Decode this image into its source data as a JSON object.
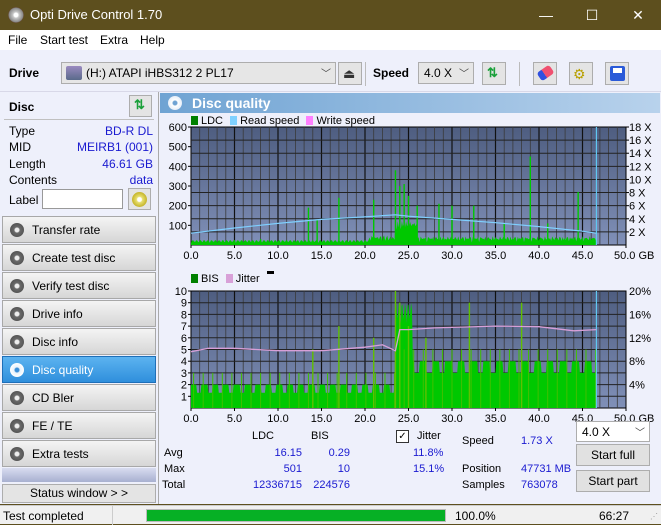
{
  "window": {
    "title": "Opti Drive Control 1.70",
    "minimize": "—",
    "maximize": "☐",
    "close": "✕"
  },
  "menu": [
    "File",
    "Start test",
    "Extra",
    "Help"
  ],
  "toolbar": {
    "drive_label": "Drive",
    "drive_value": "(H:)  ATAPI iHBS312  2 PL17",
    "speed_label": "Speed",
    "speed_value": "4.0 X"
  },
  "disc": {
    "header": "Disc",
    "rows": [
      {
        "key": "Type",
        "value": "BD-R DL"
      },
      {
        "key": "MID",
        "value": "MEIRB1 (001)"
      },
      {
        "key": "Length",
        "value": "46.61 GB"
      },
      {
        "key": "Contents",
        "value": "data"
      }
    ],
    "label_key": "Label",
    "label_value": ""
  },
  "nav": [
    {
      "label": "Transfer rate",
      "active": false
    },
    {
      "label": "Create test disc",
      "active": false
    },
    {
      "label": "Verify test disc",
      "active": false
    },
    {
      "label": "Drive info",
      "active": false
    },
    {
      "label": "Disc info",
      "active": false
    },
    {
      "label": "Disc quality",
      "active": true
    },
    {
      "label": "CD Bler",
      "active": false
    },
    {
      "label": "FE / TE",
      "active": false
    },
    {
      "label": "Extra tests",
      "active": false
    }
  ],
  "status_window_btn": "Status window > >",
  "panel_title": "Disc quality",
  "colors": {
    "ldc": "#00c800",
    "read_speed": "#7fd0ff",
    "write_speed": "#ff80ff",
    "bis": "#00c800",
    "jitter": "#d8a0d8",
    "plot_bg_top": "#4e5d80",
    "plot_bg_bottom": "#8090b8",
    "progress": "#06b025"
  },
  "chart_data": [
    {
      "type": "bar",
      "title": "LDC / Read speed",
      "legend": [
        "LDC",
        "Read speed",
        "Write speed"
      ],
      "xlabel": "GB",
      "x_ticks": [
        "0.0",
        "5.0",
        "10.0",
        "15.0",
        "20.0",
        "25.0",
        "30.0",
        "35.0",
        "40.0",
        "45.0",
        "50.0 GB"
      ],
      "y_ticks_left": [
        "100",
        "200",
        "300",
        "400",
        "500",
        "600"
      ],
      "y_ticks_right": [
        "2 X",
        "4 X",
        "6 X",
        "8 X",
        "10 X",
        "12 X",
        "14 X",
        "16 X",
        "18 X"
      ],
      "xlim": [
        0,
        50
      ],
      "ylim_left": [
        0,
        600
      ],
      "ylim_right": [
        0,
        18
      ],
      "ldc_peaks": [
        [
          1.0,
          15
        ],
        [
          5.0,
          25
        ],
        [
          8.0,
          30
        ],
        [
          13.5,
          190
        ],
        [
          14.5,
          130
        ],
        [
          17.0,
          240
        ],
        [
          21.0,
          230
        ],
        [
          23.5,
          380
        ],
        [
          24.0,
          300
        ],
        [
          24.5,
          310
        ],
        [
          25.0,
          250
        ],
        [
          26.0,
          200
        ],
        [
          28.5,
          210
        ],
        [
          30.0,
          200
        ],
        [
          32.5,
          200
        ],
        [
          36.0,
          110
        ],
        [
          39.0,
          450
        ],
        [
          41.0,
          110
        ],
        [
          44.5,
          270
        ]
      ],
      "ldc_baseline": 18,
      "read_speed": [
        [
          0,
          1.8
        ],
        [
          5,
          2.6
        ],
        [
          10,
          3.3
        ],
        [
          15,
          3.9
        ],
        [
          20,
          4.3
        ],
        [
          23.5,
          4.6
        ],
        [
          25,
          4.4
        ],
        [
          30,
          3.9
        ],
        [
          35,
          3.4
        ],
        [
          40,
          2.8
        ],
        [
          45,
          2.1
        ],
        [
          46.6,
          1.8
        ]
      ],
      "end_marker_gb": 46.6
    },
    {
      "type": "bar",
      "title": "BIS / Jitter",
      "legend": [
        "BIS",
        "Jitter"
      ],
      "xlabel": "GB",
      "x_ticks": [
        "0.0",
        "5.0",
        "10.0",
        "15.0",
        "20.0",
        "25.0",
        "30.0",
        "35.0",
        "40.0",
        "45.0",
        "50.0 GB"
      ],
      "y_ticks_left": [
        "1",
        "2",
        "3",
        "4",
        "5",
        "6",
        "7",
        "8",
        "9",
        "10"
      ],
      "y_ticks_right": [
        "4%",
        "8%",
        "12%",
        "16%",
        "20%"
      ],
      "xlim": [
        0,
        50
      ],
      "ylim_left": [
        0,
        10
      ],
      "ylim_right": [
        0,
        20
      ],
      "bis_baseline_low": 2,
      "bis_baseline_high": 3,
      "bis_peaks": [
        [
          14.0,
          5
        ],
        [
          17.0,
          7
        ],
        [
          21.0,
          6
        ],
        [
          23.5,
          10
        ],
        [
          24.0,
          9
        ],
        [
          25.0,
          7
        ],
        [
          27.0,
          6
        ],
        [
          32.0,
          9
        ],
        [
          38.0,
          9
        ]
      ],
      "jitter": [
        [
          0,
          9.6
        ],
        [
          2,
          10.2
        ],
        [
          5,
          10.2
        ],
        [
          10,
          9.8
        ],
        [
          15,
          9.8
        ],
        [
          20,
          10.4
        ],
        [
          22,
          10.8
        ],
        [
          23.5,
          9.8
        ],
        [
          24.0,
          13.4
        ],
        [
          25,
          13.4
        ],
        [
          28,
          13.7
        ],
        [
          35,
          14.0
        ],
        [
          40,
          13.9
        ],
        [
          44,
          13.2
        ],
        [
          46.6,
          13.4
        ]
      ],
      "end_marker_gb": 46.6
    }
  ],
  "stats": {
    "col_ldc": "LDC",
    "col_bis": "BIS",
    "rows": [
      {
        "label": "Avg",
        "ldc": "16.15",
        "bis": "0.29",
        "jitter": "11.8%"
      },
      {
        "label": "Max",
        "ldc": "501",
        "bis": "10",
        "jitter": "15.1%"
      },
      {
        "label": "Total",
        "ldc": "12336715",
        "bis": "224576",
        "jitter": ""
      }
    ],
    "jitter_label": "Jitter",
    "jitter_checked": true,
    "speed_label": "Speed",
    "speed_value": "1.73 X",
    "position_label": "Position",
    "position_value": "47731 MB",
    "samples_label": "Samples",
    "samples_value": "763078",
    "speed_select": "4.0 X",
    "start_full": "Start full",
    "start_part": "Start part"
  },
  "status": {
    "text": "Test completed",
    "progress": 100.0,
    "progress_text": "100.0%",
    "elapsed": "66:27"
  }
}
